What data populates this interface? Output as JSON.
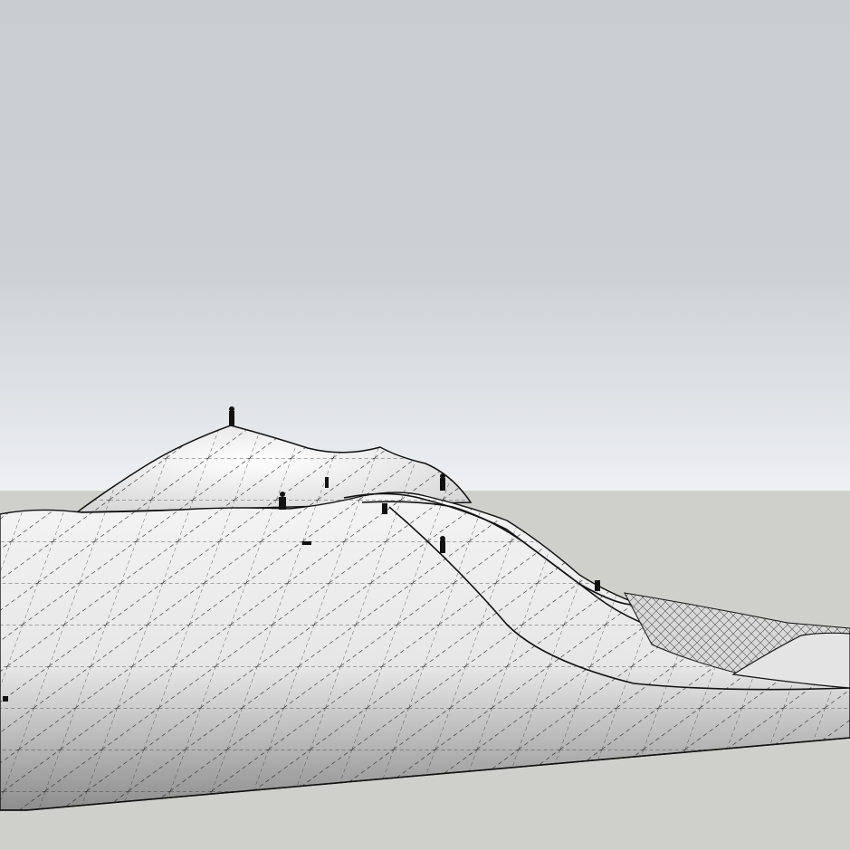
{
  "scene": {
    "sky_color": "#cdd1d5",
    "ground_color": "#cfd0cb",
    "terrain_color": "#f2f2f2",
    "edge_color": "#111111"
  }
}
